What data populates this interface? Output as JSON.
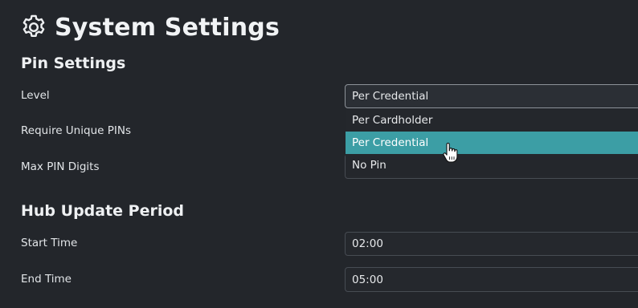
{
  "page": {
    "title": "System Settings",
    "icon": "gear-icon"
  },
  "pin_settings": {
    "heading": "Pin Settings",
    "level": {
      "label": "Level",
      "value": "Per Credential",
      "options": [
        "Per Cardholder",
        "Per Credential",
        "No Pin"
      ],
      "highlighted_option": "Per Credential"
    },
    "require_unique": {
      "label": "Require Unique PINs"
    },
    "max_pin_digits": {
      "label": "Max PIN Digits",
      "value": ""
    }
  },
  "hub_update_period": {
    "heading": "Hub Update Period",
    "start_time": {
      "label": "Start Time",
      "value": "02:00"
    },
    "end_time": {
      "label": "End Time",
      "value": "05:00"
    }
  },
  "colors": {
    "background": "#23262b",
    "accent": "#3c9ea5",
    "field_border": "#474c53",
    "text": "#e6e8ea"
  }
}
